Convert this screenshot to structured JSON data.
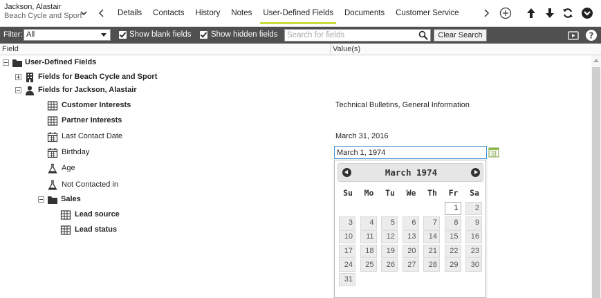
{
  "record": {
    "name": "Jackson, Alastair",
    "company": "Beach Cycle and Sport"
  },
  "tabs": [
    {
      "label": "Details"
    },
    {
      "label": "Contacts"
    },
    {
      "label": "History"
    },
    {
      "label": "Notes"
    },
    {
      "label": "User-Defined Fields"
    },
    {
      "label": "Documents"
    },
    {
      "label": "Customer Service"
    }
  ],
  "active_tab": "User-Defined Fields",
  "toolbar_icons": [
    "add-circle-icon",
    "arrow-up-icon",
    "arrow-down-icon",
    "refresh-icon",
    "collapse-icon"
  ],
  "filter": {
    "label": "Filter:",
    "value": "All",
    "show_blank_label": "Show blank fields",
    "show_hidden_label": "Show hidden fields",
    "search_placeholder": "Search for fields",
    "clear_label": "Clear Search"
  },
  "columns": {
    "field": "Field",
    "value": "Value(s)"
  },
  "tree": {
    "root": "User-Defined Fields",
    "group_company": "Fields for Beach Cycle and Sport",
    "group_contact": "Fields for Jackson, Alastair",
    "customer_interests": {
      "label": "Customer Interests",
      "value": "Technical Bulletins, General Information"
    },
    "partner_interests": {
      "label": "Partner Interests"
    },
    "last_contact": {
      "label": "Last Contact Date",
      "value": "March 31, 2016"
    },
    "birthday": {
      "label": "Birthday",
      "value": "March 1, 1974"
    },
    "age": {
      "label": "Age"
    },
    "not_contacted": {
      "label": "Not Contacted in"
    },
    "sales": {
      "label": "Sales"
    },
    "lead_source": {
      "label": "Lead source"
    },
    "lead_status": {
      "label": "Lead status"
    }
  },
  "datepicker": {
    "title": "March 1974",
    "dow": [
      "Su",
      "Mo",
      "Tu",
      "We",
      "Th",
      "Fr",
      "Sa"
    ],
    "first_weekday": 5,
    "days_in_month": 31,
    "selected_day": 1
  },
  "colors": {
    "active_tab_underline": "#c8dc3c",
    "filter_bar": "#505050",
    "input_focus": "#3d8fd4"
  }
}
